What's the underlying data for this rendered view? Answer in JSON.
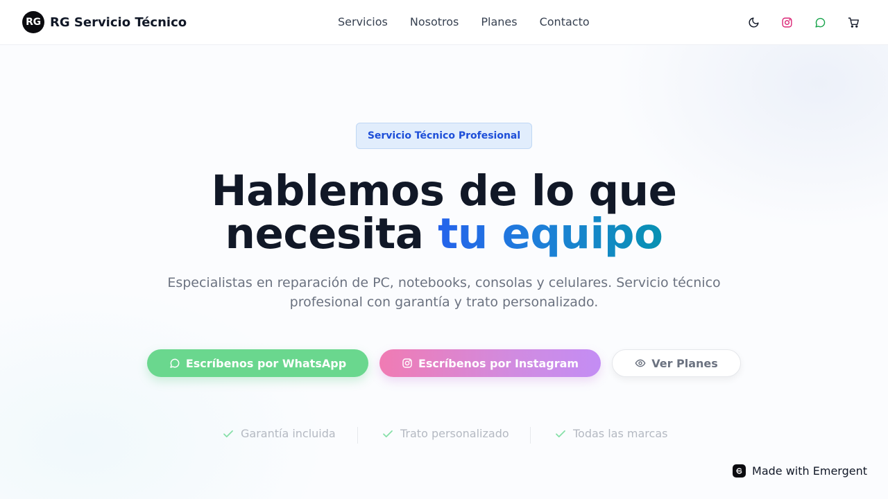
{
  "brand": {
    "logo_text": "RG",
    "name": "RG Servicio Técnico"
  },
  "nav": {
    "links": [
      "Servicios",
      "Nosotros",
      "Planes",
      "Contacto"
    ],
    "icons": [
      "moon-icon",
      "instagram-icon",
      "whatsapp-icon",
      "cart-icon"
    ]
  },
  "hero": {
    "badge": "Servicio Técnico Profesional",
    "title_line1": "Hablemos de lo que",
    "title_line2_plain": "necesita ",
    "title_line2_accent": "tu equipo",
    "subtitle": "Especialistas en reparación de PC, notebooks, consolas y celulares. Servicio técnico profesional con garantía y trato personalizado."
  },
  "buttons": {
    "whatsapp": "Escríbenos por WhatsApp",
    "instagram": "Escríbenos por Instagram",
    "plans": "Ver Planes"
  },
  "features": [
    "Garantía incluida",
    "Trato personalizado",
    "Todas las marcas"
  ],
  "footer_badge": "Made with Emergent",
  "colors": {
    "accent_blue": "#2563eb",
    "accent_cyan": "#0891b2",
    "whatsapp_green": "#6ad78e",
    "instagram_pink": "#f07bb3",
    "instagram_purple": "#c38df4",
    "check_green": "#86e0a8"
  }
}
